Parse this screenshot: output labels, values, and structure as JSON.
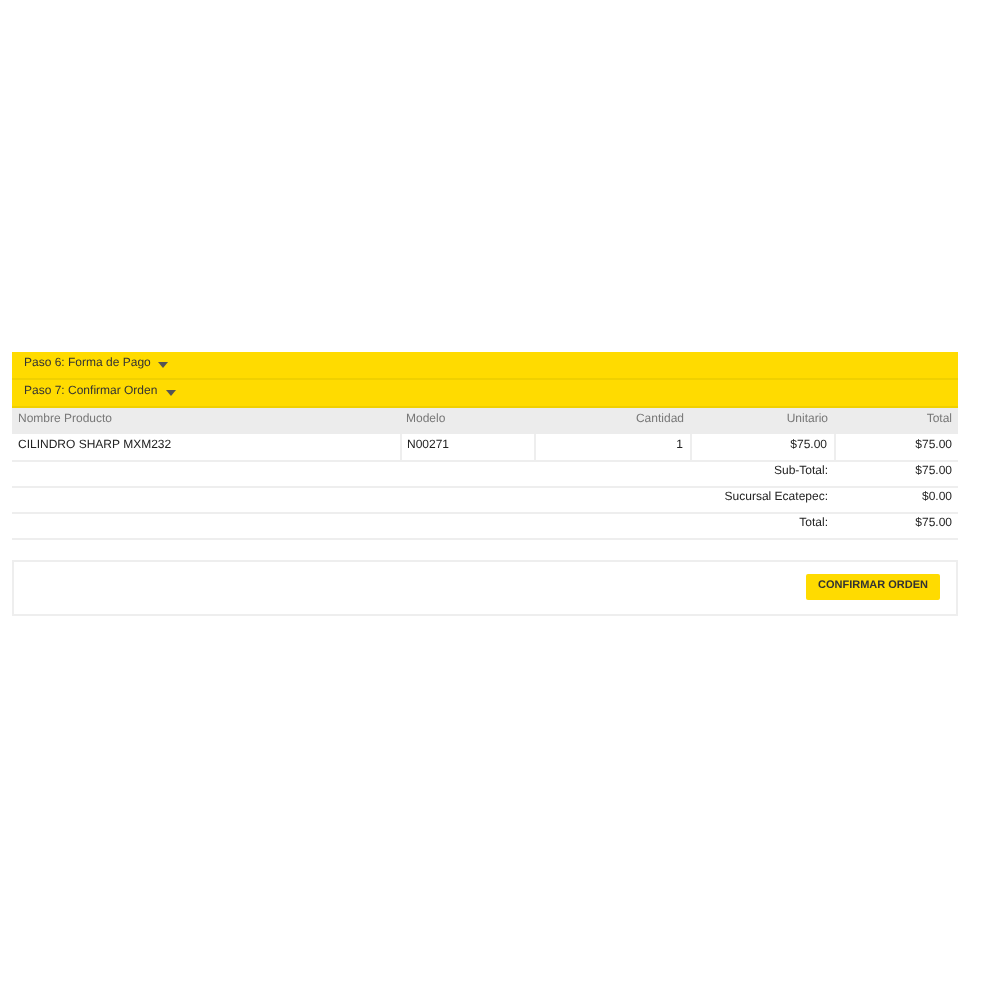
{
  "steps": [
    {
      "label": "Paso 6: Forma de Pago"
    },
    {
      "label": "Paso 7: Confirmar Orden"
    }
  ],
  "table": {
    "columns": [
      "Nombre Producto",
      "Modelo",
      "Cantidad",
      "Unitario",
      "Total"
    ],
    "rows": [
      [
        "CILINDRO SHARP MXM232",
        "N00271",
        "1",
        "$75.00",
        "$75.00"
      ]
    ],
    "totals": [
      {
        "label": "Sub-Total:",
        "value": "$75.00"
      },
      {
        "label": "Sucursal Ecatepec:",
        "value": "$0.00"
      },
      {
        "label": "Total:",
        "value": "$75.00"
      }
    ]
  },
  "confirm_button": "CONFIRMAR ORDEN"
}
